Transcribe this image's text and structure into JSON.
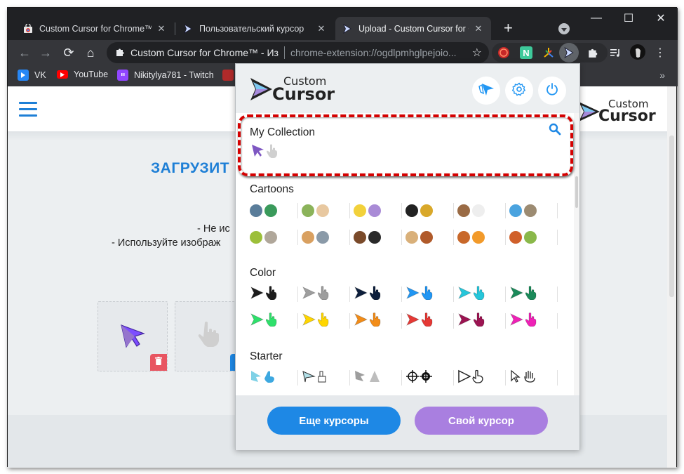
{
  "browser": {
    "tabs": [
      {
        "title": "Custom Cursor for Chrome™ -",
        "favicon": "webstore-icon",
        "active": false
      },
      {
        "title": "Пользовательский курсор",
        "favicon": "cursor-icon",
        "active": false
      },
      {
        "title": "Upload - Custom Cursor for Ch",
        "favicon": "cursor-icon",
        "active": true
      }
    ],
    "new_tab": "+",
    "window_controls": {
      "minimize": "—",
      "maximize": "☐",
      "close": "✕"
    },
    "omnibox": {
      "site_name": "Custom Cursor for Chrome™ - Из",
      "url": "chrome-extension://ogdlpmhglpejoio..."
    },
    "extensions": [
      "red-circle-extension-icon",
      "n-extension-icon",
      "colorful-extension-icon",
      "custom-cursor-extension-icon",
      "puzzle-extensions-icon",
      "media-queue-icon",
      "profile-avatar",
      "menu-icon"
    ],
    "bookmarks": [
      {
        "label": "VK",
        "color": "#2787f5"
      },
      {
        "label": "YouTube",
        "color": "#ff0000"
      },
      {
        "label": "Nikitylya781 - Twitch",
        "color": "#9146ff"
      },
      {
        "label": "",
        "color": "#b02a2a"
      }
    ],
    "bookmarks_overflow": "»"
  },
  "page": {
    "logo_top": "Custom",
    "logo_bottom": "Cursor",
    "title": "ЗАГРУЗИТ",
    "rules": [
      "- Не ис",
      "- Используйте изображ"
    ],
    "slots": [
      {
        "name": "pointer",
        "filled": true
      },
      {
        "name": "hand",
        "filled": false
      }
    ]
  },
  "popup": {
    "logo_top": "Custom",
    "logo_bottom": "Cursor",
    "header_buttons": [
      "cursor-mode",
      "settings",
      "power"
    ],
    "sections": [
      {
        "title": "My Collection",
        "items": [
          {
            "pointer": "#7e57c2",
            "hand": "#d0d0d0"
          }
        ]
      },
      {
        "title": "Cartoons",
        "rows": [
          [
            {
              "a": "#5a7d9a",
              "b": "#3a9a5b"
            },
            {
              "a": "#8bb35a",
              "b": "#e8c8a0"
            },
            {
              "a": "#f2d13b",
              "b": "#a98bd6"
            },
            {
              "a": "#222222",
              "b": "#d9a82a"
            },
            {
              "a": "#9a6b45",
              "b": "#eeeeee"
            },
            {
              "a": "#4aa3df",
              "b": "#9c8b72"
            }
          ],
          [
            {
              "a": "#9cbf3a",
              "b": "#b0a79a"
            },
            {
              "a": "#d9a060",
              "b": "#8a9aa8"
            },
            {
              "a": "#7a4a2a",
              "b": "#2a2a2a"
            },
            {
              "a": "#d9b07a",
              "b": "#b05a2a"
            },
            {
              "a": "#c8682a",
              "b": "#f29a2a"
            },
            {
              "a": "#d0602a",
              "b": "#8ab84a"
            }
          ]
        ]
      },
      {
        "title": "Color",
        "rows": [
          [
            "#1c1c1c",
            "#9e9e9e",
            "#0d1f3c",
            "#2196f3",
            "#26c6da",
            "#1b8a5a"
          ],
          [
            "#2ee06b",
            "#ffd600",
            "#f28c18",
            "#e53935",
            "#9c1452",
            "#ee22b6"
          ]
        ]
      },
      {
        "title": "Starter",
        "rows": [
          [
            "#5bc0de",
            "#7fa7b8",
            "#9e9e9e",
            "#111111",
            "#222222",
            "#333333"
          ]
        ]
      }
    ],
    "buttons": {
      "more": "Еще курсоры",
      "own": "Свой курсор"
    },
    "colors": {
      "more_btn": "#1e88e5",
      "own_btn": "#a97fe0",
      "highlight": "#d50000",
      "accent": "#1e88e5"
    }
  }
}
